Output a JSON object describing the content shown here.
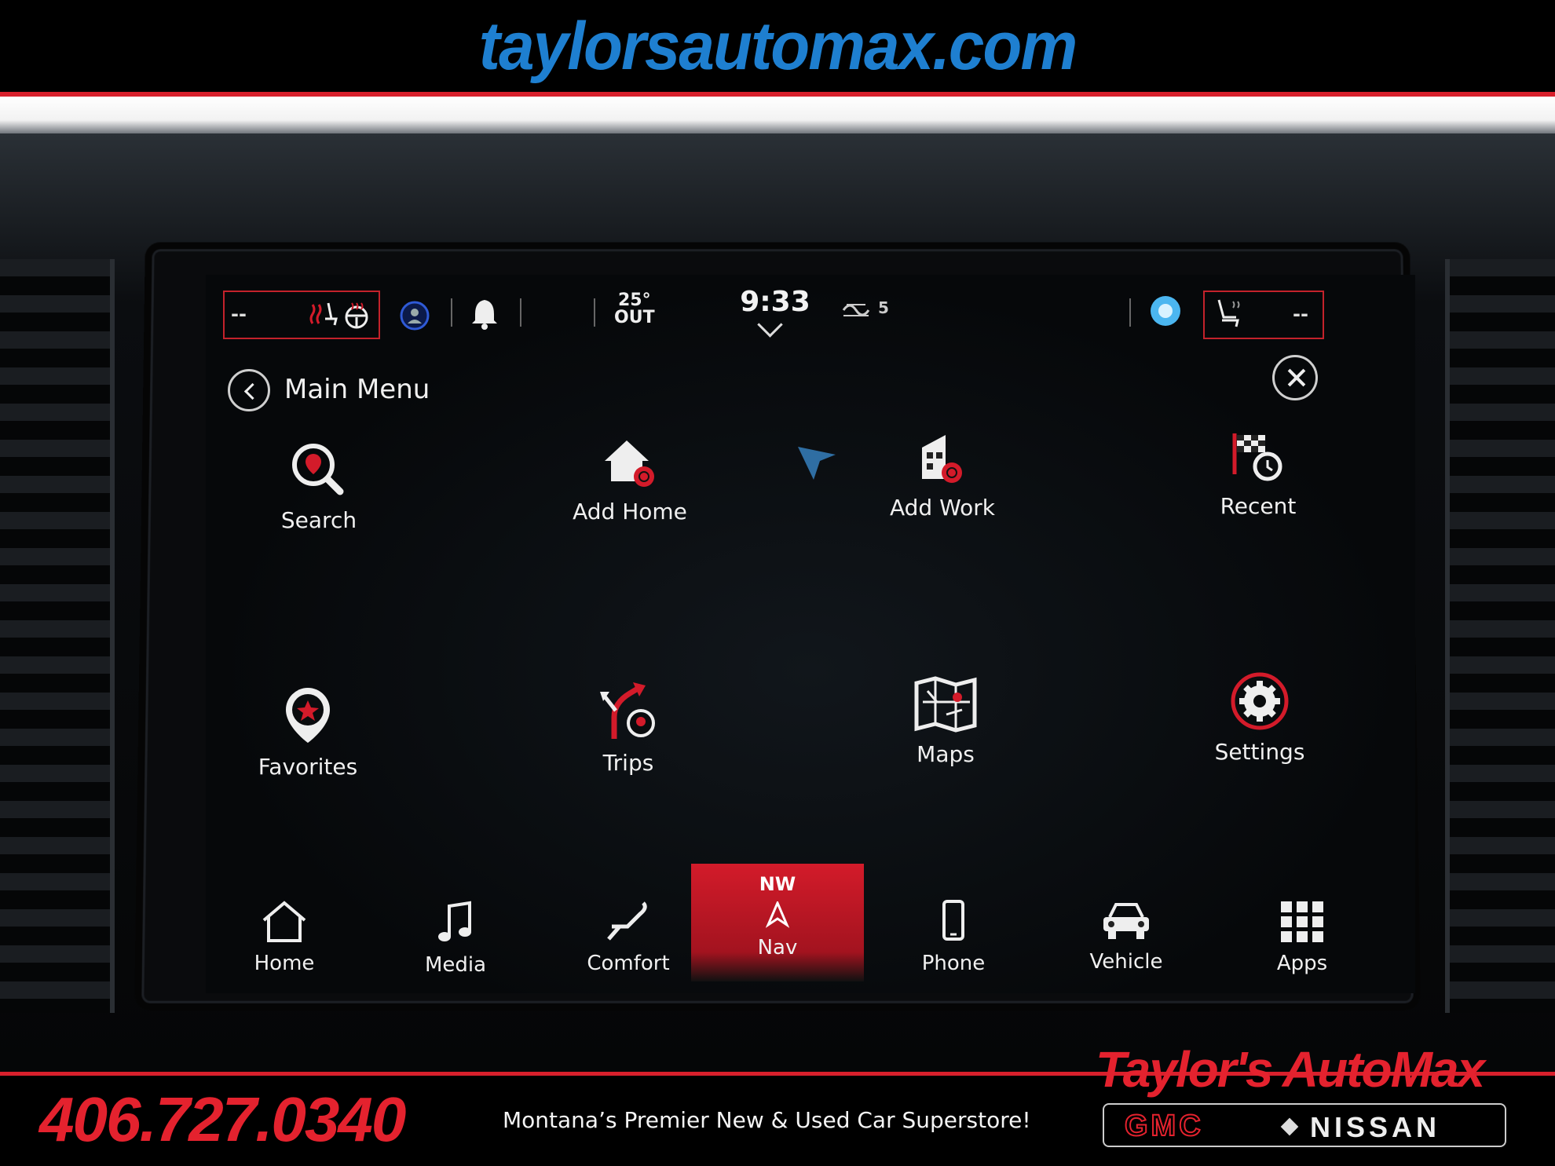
{
  "dealer": {
    "website": "taylorsautomax.com",
    "phone": "406.727.0340",
    "tagline": "Montana’s Premier New & Used Car Superstore!",
    "brand_name": "Taylor's AutoMax",
    "gmc": "GMC",
    "nissan": "NISSAN"
  },
  "status_bar": {
    "left_climate_value": "--",
    "right_climate_value": "--",
    "outside_temp": "25°",
    "outside_label": "OUT",
    "time": "9:33",
    "siriusxm_channel": "5"
  },
  "menu": {
    "title": "Main Menu",
    "items": [
      {
        "label": "Search",
        "icon": "search-pin-icon"
      },
      {
        "label": "Add Home",
        "icon": "home-add-icon"
      },
      {
        "label": "Add Work",
        "icon": "building-add-icon"
      },
      {
        "label": "Recent",
        "icon": "recent-flag-icon"
      },
      {
        "label": "Favorites",
        "icon": "favorite-pin-icon"
      },
      {
        "label": "Trips",
        "icon": "trips-icon"
      },
      {
        "label": "Maps",
        "icon": "map-icon"
      },
      {
        "label": "Settings",
        "icon": "gear-icon"
      }
    ]
  },
  "dock": {
    "items": [
      {
        "label": "Home",
        "icon": "home-icon"
      },
      {
        "label": "Media",
        "icon": "music-note-icon"
      },
      {
        "label": "Comfort",
        "icon": "seat-icon"
      },
      {
        "label": "Nav",
        "icon": "compass-arrow-icon",
        "direction": "NW",
        "active": true
      },
      {
        "label": "Phone",
        "icon": "phone-icon"
      },
      {
        "label": "Vehicle",
        "icon": "car-icon"
      },
      {
        "label": "Apps",
        "icon": "grid-icon"
      }
    ]
  },
  "colors": {
    "accent_red": "#d31b2a",
    "site_blue": "#1e7fd0",
    "screen_bg": "#06080a"
  }
}
